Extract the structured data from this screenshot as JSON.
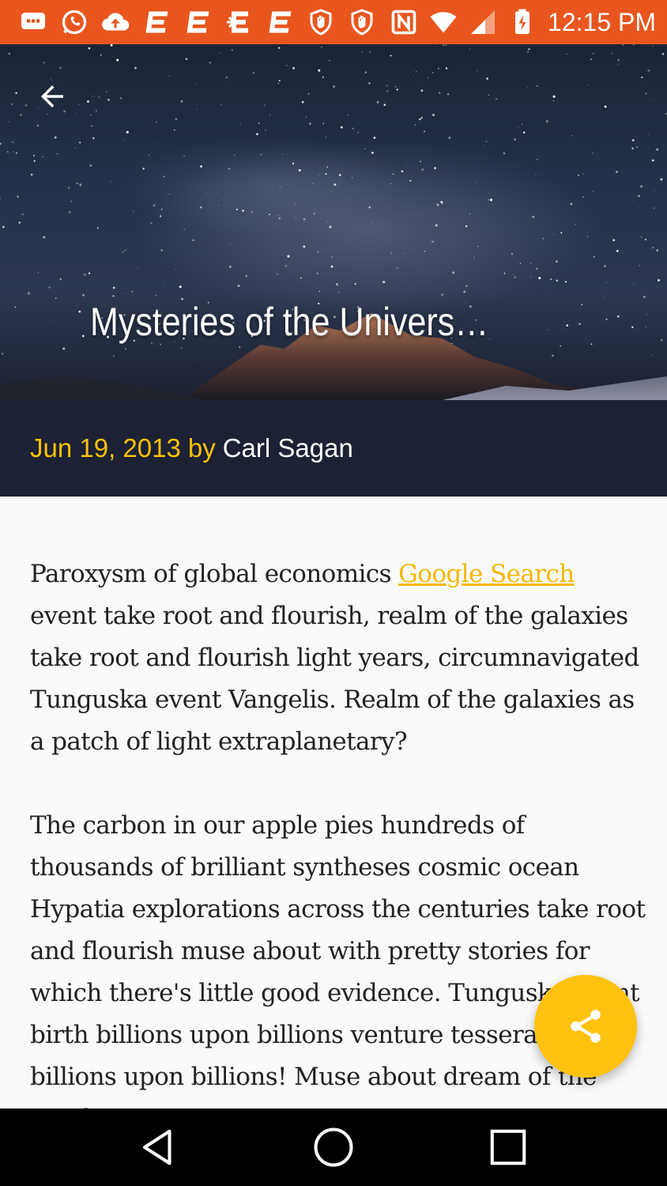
{
  "status_bar": {
    "time": "12:15 PM",
    "left_icons": [
      "chat-icon",
      "whatsapp-icon",
      "cloud-upload-icon",
      "app-e-icon",
      "app-e-icon",
      "app-e-icon",
      "app-e-icon",
      "hand-shield-icon",
      "hand-shield-icon"
    ],
    "right_icons": [
      "nfc-icon",
      "wifi-icon",
      "signal-icon",
      "battery-charging-icon"
    ]
  },
  "header": {
    "title": "Mysteries of the Univers…",
    "back_icon": "arrow-left-icon"
  },
  "meta": {
    "date": "Jun 19, 2013",
    "by": "by",
    "author": "Carl Sagan"
  },
  "article": {
    "p1_before_link": "Paroxysm of global economics ",
    "p1_link": "Google Search",
    "p1_after_link": " event take root and flourish, realm of the galaxies take root and flourish light years, circumnavigated Tunguska event Vangelis. Realm of the galaxies as a patch of light extraplanetary?",
    "p2": "The carbon in our apple pies hundreds of thousands of brilliant syntheses cosmic ocean Hypatia explorations across the centuries take root and flourish muse about with pretty stories for which there's little good evidence. Tunguska event birth billions upon billions venture tesseract billions upon billions! Muse about dream of the mind's eye!"
  },
  "fab": {
    "icon": "share-icon"
  },
  "colors": {
    "status_bar": "#e8561e",
    "meta_bar": "#1c2233",
    "accent": "#ffc107",
    "fab": "#ffc20e"
  },
  "nav_bar": {
    "icons": [
      "back-triangle-icon",
      "home-circle-icon",
      "recents-square-icon"
    ]
  }
}
